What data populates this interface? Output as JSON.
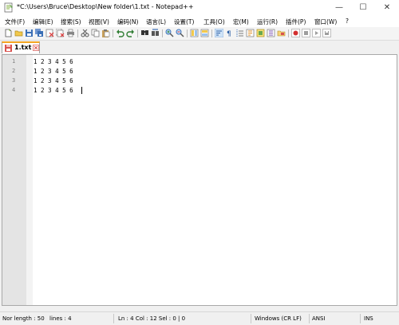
{
  "window": {
    "title": "*C:\\Users\\Bruce\\Desktop\\New folder\\1.txt - Notepad++",
    "minimize_glyph": "—",
    "maximize_glyph": "☐",
    "close_glyph": "✕"
  },
  "menu": {
    "items": [
      "文件(F)",
      "编辑(E)",
      "搜索(S)",
      "视图(V)",
      "编码(N)",
      "语言(L)",
      "设置(T)",
      "工具(O)",
      "宏(M)",
      "运行(R)",
      "插件(P)",
      "窗口(W)",
      "?"
    ]
  },
  "toolbar": {
    "icons": [
      "new-file-icon",
      "open-file-icon",
      "save-icon",
      "save-all-icon",
      "close-icon",
      "close-all-icon",
      "print-icon",
      "cut-icon",
      "copy-icon",
      "paste-icon",
      "undo-icon",
      "redo-icon",
      "find-icon",
      "replace-icon",
      "zoom-in-icon",
      "zoom-out-icon",
      "sync-vertical-icon",
      "sync-horizontal-icon",
      "word-wrap-icon",
      "show-all-chars-icon",
      "indent-guide-icon",
      "lang-define-icon",
      "doc-map-icon",
      "function-list-icon",
      "folder-as-workspace-icon",
      "record-macro-icon",
      "stop-record-icon",
      "play-macro-icon",
      "save-macro-icon"
    ]
  },
  "tabs": [
    {
      "label": "1.txt",
      "modified": true
    }
  ],
  "editor": {
    "line_numbers": [
      "1",
      "2",
      "3",
      "4"
    ],
    "lines": [
      "1 2 3 4 5 6",
      "1 2 3 4 5 6",
      "1 2 3 4 5 6",
      "1 2 3 4 5 6"
    ]
  },
  "status": {
    "length": "Nor length : 50",
    "lines": "lines : 4",
    "position": "Ln : 4    Col : 12    Sel : 0 | 0",
    "eol": "Windows (CR LF)",
    "encoding": "ANSI",
    "mode": "INS"
  },
  "colors": {
    "tab_accent": "#f5a623",
    "gutter": "#e4e4e4",
    "tab_modified_icon": "#d9534f"
  }
}
